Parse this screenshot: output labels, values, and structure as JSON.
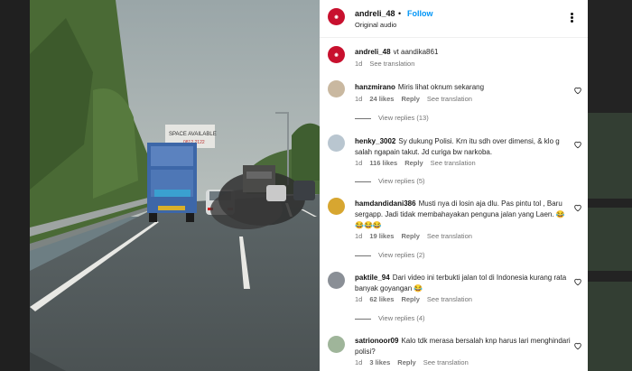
{
  "post": {
    "username": "andreli_48",
    "separator": "•",
    "follow_label": "Follow",
    "audio": "Original audio",
    "more_icon": "more-horizontal-icon"
  },
  "caption": {
    "username": "andreli_48",
    "text": "vt aandika861",
    "age": "1d",
    "translate": "See translation"
  },
  "comments": [
    {
      "username": "hanzmirano",
      "text": "Miris lihat oknum sekarang",
      "age": "1d",
      "likes": "24 likes",
      "reply": "Reply",
      "translate": "See translation",
      "view_replies": "View replies (13)"
    },
    {
      "username": "henky_3002",
      "text": "Sy dukung Polisi. Krn itu sdh over dimensi, & klo g salah ngapain takut. Jd curiga bw narkoba.",
      "age": "1d",
      "likes": "116 likes",
      "reply": "Reply",
      "translate": "See translation",
      "view_replies": "View replies (5)"
    },
    {
      "username": "hamdandidani386",
      "text": "Musti nya di losin aja dlu. Pas pintu tol , Baru sergapp. Jadi tidak membahayakan penguna jalan yang Laen. 😂😂😂😂",
      "age": "1d",
      "likes": "19 likes",
      "reply": "Reply",
      "translate": "See translation",
      "view_replies": "View replies (2)"
    },
    {
      "username": "paktile_94",
      "text": "Dari video ini terbukti jalan tol di Indonesia kurang rata banyak goyangan 😂",
      "age": "1d",
      "likes": "62 likes",
      "reply": "Reply",
      "translate": "See translation",
      "view_replies": "View replies (4)"
    },
    {
      "username": "satrionoor09",
      "text": "Kalo tdk merasa bersalah knp harus lari menghindari polisi?",
      "age": "1d",
      "likes": "3 likes",
      "reply": "Reply",
      "translate": "See translation"
    }
  ],
  "video_scene": {
    "billboard_text": "SPACE AVAILABLE",
    "billboard_phone": "0812 2122"
  },
  "colors": {
    "accent": "#0095f6",
    "brand_avatar": "#c8102e",
    "muted": "#737373"
  }
}
